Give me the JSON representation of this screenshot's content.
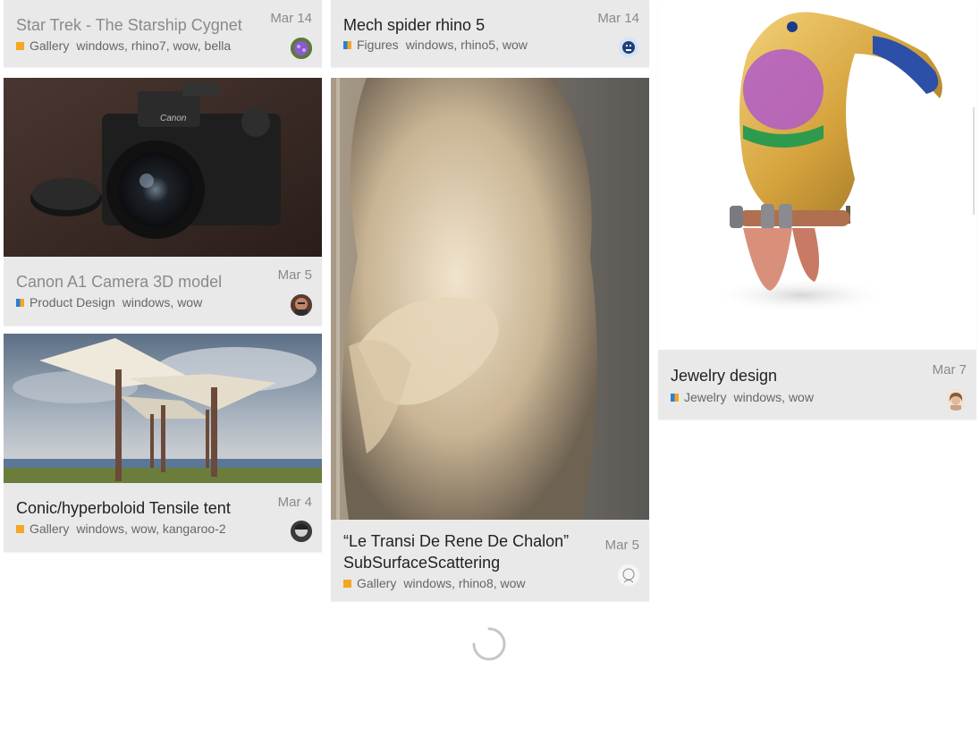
{
  "posts": [
    {
      "title": "Star Trek - The Starship Cygnet",
      "date": "Mar 14",
      "category": "Gallery",
      "tags": "windows, rhino7, wow, bella",
      "category_color": "#f5a623"
    },
    {
      "title": "Mech spider rhino 5",
      "date": "Mar 14",
      "category": "Figures",
      "tags": "windows, rhino5, wow",
      "category_color": "#f5a623",
      "category_color2": "#2b7fd4"
    },
    {
      "title": "Canon A1 Camera 3D model",
      "date": "Mar 5",
      "category": "Product Design",
      "tags": "windows, wow",
      "category_color": "#f5a623",
      "category_color2": "#2b7fd4"
    },
    {
      "title": "“Le Transi De Rene De Chalon” SubSurfaceScattering",
      "date": "Mar 5",
      "category": "Gallery",
      "tags": "windows, rhino8, wow",
      "category_color": "#f5a623"
    },
    {
      "title": "Conic/hyperboloid Tensile tent",
      "date": "Mar 4",
      "category": "Gallery",
      "tags": "windows, wow, kangaroo-2",
      "category_color": "#f5a623"
    },
    {
      "title": "Jewelry design",
      "date": "Mar 7",
      "category": "Jewelry",
      "tags": "windows, wow",
      "category_color": "#f5a623",
      "category_color2": "#2b7fd4"
    }
  ]
}
